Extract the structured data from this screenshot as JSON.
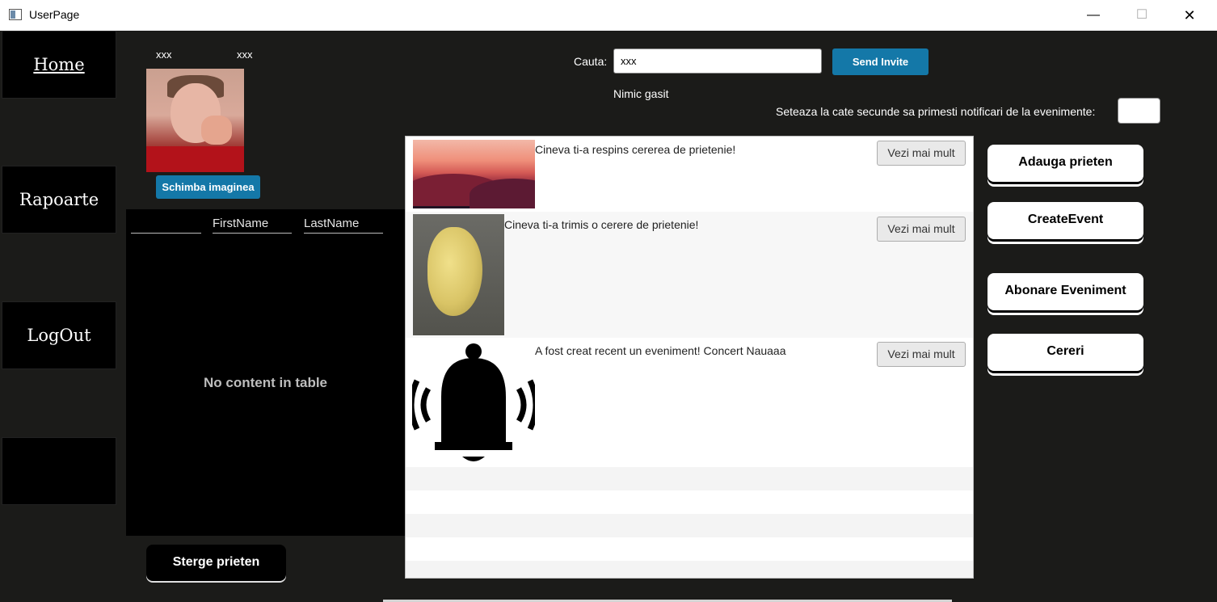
{
  "window": {
    "title": "UserPage",
    "minimize": "—",
    "maximize": "☐",
    "close": "✕"
  },
  "nav": {
    "home": "Home",
    "rapoarte": "Rapoarte",
    "logout": "LogOut"
  },
  "profile": {
    "first": "xxx",
    "last": "xxx",
    "change_image": "Schimba imaginea"
  },
  "friends_table": {
    "columns": [
      "",
      "FirstName",
      "LastName"
    ],
    "empty_text": "No content in table",
    "delete_button": "Sterge prieten"
  },
  "search": {
    "label": "Cauta:",
    "value": "xxx",
    "send_button": "Send Invite",
    "result": "Nimic gasit"
  },
  "notifications_setting": {
    "label": "Seteaza la cate secunde sa primesti notificari de la evenimente:",
    "value": ""
  },
  "notifications": [
    {
      "text": "Cineva ti-a respins cererea de prietenie!",
      "button": "Vezi mai mult",
      "icon": "landscape-image"
    },
    {
      "text": "Cineva ti-a trimis o cerere de prietenie!",
      "button": "Vezi mai mult",
      "icon": "potato-image"
    },
    {
      "text": "A fost creat recent un eveniment! Concert Nauaaa",
      "button": "Vezi mai mult",
      "icon": "bell-icon"
    }
  ],
  "actions": {
    "add_friend": "Adauga prieten",
    "create_event": "CreateEvent",
    "subscribe_event": "Abonare Eveniment",
    "requests": "Cereri"
  },
  "colors": {
    "background": "#1b1b19",
    "accent_blue": "#1478a8",
    "panel": "#000000"
  }
}
